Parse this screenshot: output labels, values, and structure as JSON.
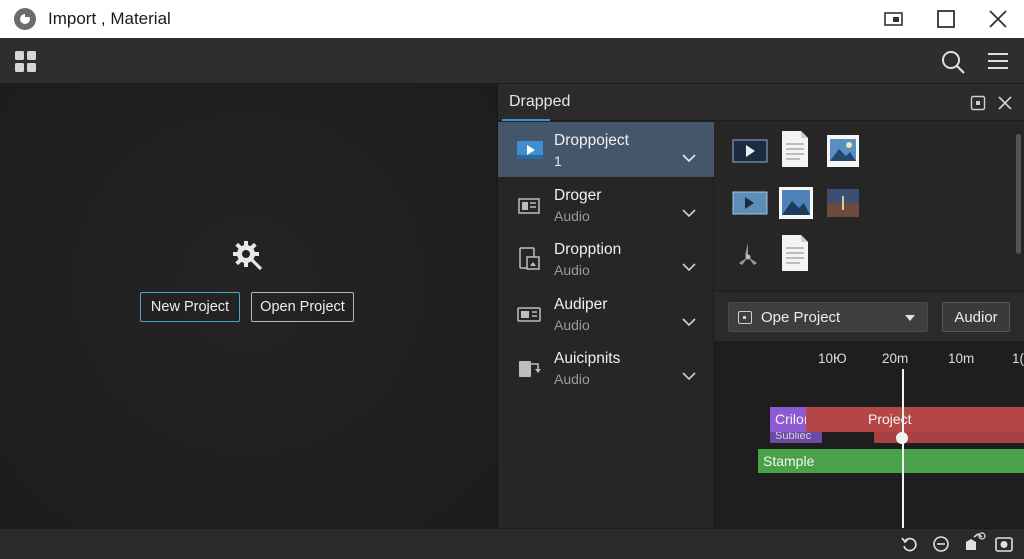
{
  "window": {
    "title": "Import , Material",
    "app_icon": "app-logo-icon",
    "controls": [
      "snap-icon",
      "maximize-icon",
      "close-icon"
    ]
  },
  "toolbar": {
    "left_icon": "grid-apps-icon",
    "right_icons": [
      "search-icon",
      "menu-icon"
    ]
  },
  "welcome": {
    "icon": "gear-search-icon",
    "new_project_label": "New Project",
    "open_project_label": "Open Project"
  },
  "panel": {
    "title": "Drapped",
    "header_icons": [
      "panel-expand-icon",
      "panel-close-icon"
    ],
    "items": [
      {
        "title": "Droppoject",
        "subtitle": "1",
        "icon": "video-icon",
        "active": true
      },
      {
        "title": "Droger",
        "subtitle": "Audio",
        "icon": "clip-icon",
        "active": false
      },
      {
        "title": "Dropption",
        "subtitle": "Audio",
        "icon": "media-file-icon",
        "active": false
      },
      {
        "title": "Audiper",
        "subtitle": "Audio",
        "icon": "audio-device-icon",
        "active": false
      },
      {
        "title": "Auicipnits",
        "subtitle": "Audio",
        "icon": "export-icon",
        "active": false
      }
    ],
    "thumbnails": [
      "video-thumb-icon",
      "document-thumb-icon",
      "image-thumb-icon",
      "video-thumb-icon",
      "image-thumb-icon",
      "photo-thumb-icon",
      "fan-thumb-icon",
      "document-thumb-icon"
    ],
    "dropdown_label": "Ope Project",
    "audior_button": "Audior"
  },
  "timeline": {
    "ruler": [
      "10Ю",
      "20m",
      "10m",
      "1("
    ],
    "clips": {
      "purple": "Criloı",
      "red": "Project",
      "purple_sub": "Subliec",
      "green": "Stample"
    },
    "colors": {
      "purple": "#8d5ad4",
      "red": "#b54646",
      "green": "#49a24a",
      "accent": "#3d8fd1"
    }
  },
  "statusbar": {
    "icons": [
      "undo-icon",
      "zoom-out-icon",
      "share-icon",
      "camera-icon"
    ]
  }
}
